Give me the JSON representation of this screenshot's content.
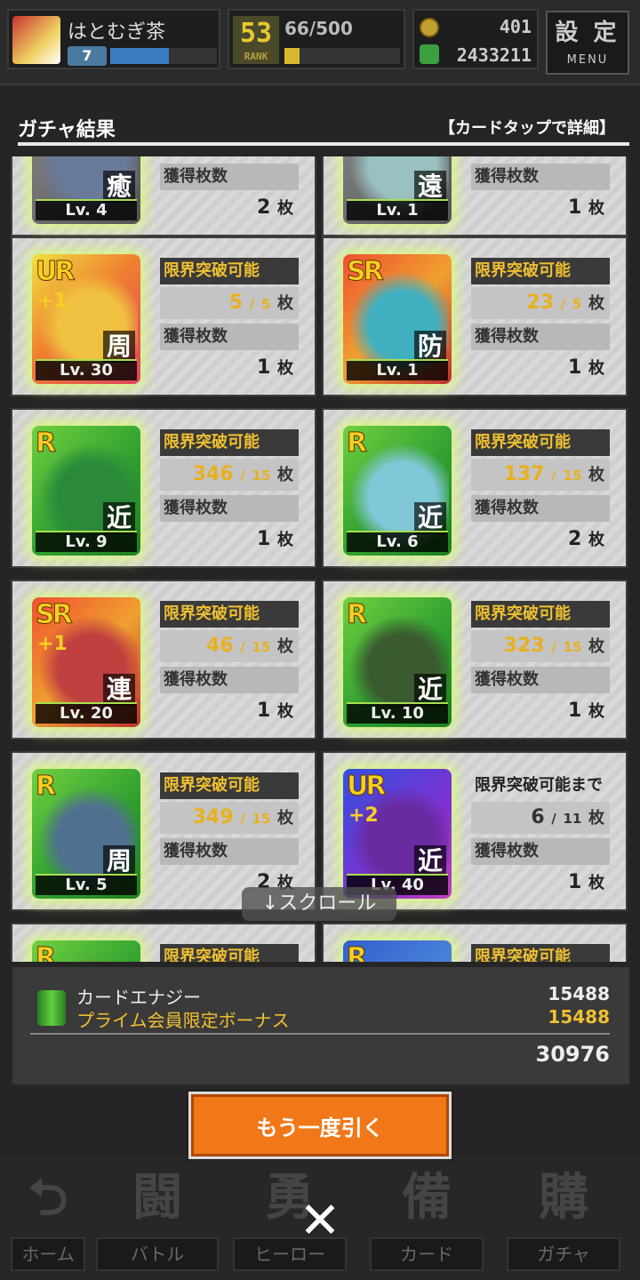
{
  "header": {
    "player_name": "はとむぎ茶",
    "player_level": "7",
    "player_exp": 0.55,
    "rank_number": "53",
    "rank_label": "RANK",
    "rank_progress": "66/500",
    "rank_fill": 0.13,
    "currency_coins": "401",
    "currency_energy": "2433211",
    "menu_kanji": "設 定",
    "menu_label": "MENU"
  },
  "title": "ガチャ結果",
  "hint": "【カードタップで詳細】",
  "cards": [
    {
      "rarity": "",
      "plus": "",
      "type": "癒",
      "level": "Lv. 4",
      "label1": "",
      "value1": "",
      "max1": "",
      "label2": "獲得枚数",
      "count": "2",
      "unit": "枚",
      "art": "#6a7a9a"
    },
    {
      "rarity": "",
      "plus": "",
      "type": "遠",
      "level": "Lv. 1",
      "label1": "",
      "value1": "",
      "max1": "",
      "label2": "獲得枚数",
      "count": "1",
      "unit": "枚",
      "art": "#9ac0c0"
    },
    {
      "rarity": "UR",
      "plus": "+1",
      "type": "周",
      "level": "Lv. 30",
      "label1": "限界突破可能",
      "value1": "5",
      "max1": "5",
      "label2": "獲得枚数",
      "count": "1",
      "unit": "枚",
      "art": "#f0c040"
    },
    {
      "rarity": "SR",
      "plus": "",
      "type": "防",
      "level": "Lv. 1",
      "label1": "限界突破可能",
      "value1": "23",
      "max1": "5",
      "label2": "獲得枚数",
      "count": "1",
      "unit": "枚",
      "art": "#40b0c0"
    },
    {
      "rarity": "R",
      "plus": "",
      "type": "近",
      "level": "Lv. 9",
      "label1": "限界突破可能",
      "value1": "346",
      "max1": "15",
      "label2": "獲得枚数",
      "count": "1",
      "unit": "枚",
      "art": "#2a8a3a"
    },
    {
      "rarity": "R",
      "plus": "",
      "type": "近",
      "level": "Lv. 6",
      "label1": "限界突破可能",
      "value1": "137",
      "max1": "15",
      "label2": "獲得枚数",
      "count": "2",
      "unit": "枚",
      "art": "#80c8d8"
    },
    {
      "rarity": "SR",
      "plus": "+1",
      "type": "連",
      "level": "Lv. 20",
      "label1": "限界突破可能",
      "value1": "46",
      "max1": "15",
      "label2": "獲得枚数",
      "count": "1",
      "unit": "枚",
      "art": "#c04040"
    },
    {
      "rarity": "R",
      "plus": "",
      "type": "近",
      "level": "Lv. 10",
      "label1": "限界突破可能",
      "value1": "323",
      "max1": "15",
      "label2": "獲得枚数",
      "count": "1",
      "unit": "枚",
      "art": "#3a5a30"
    },
    {
      "rarity": "R",
      "plus": "",
      "type": "周",
      "level": "Lv. 5",
      "label1": "限界突破可能",
      "value1": "349",
      "max1": "15",
      "label2": "獲得枚数",
      "count": "2",
      "unit": "枚",
      "art": "#507090"
    },
    {
      "rarity": "UR",
      "plus": "+2",
      "type": "近",
      "level": "Lv. 40",
      "label1": "限界突破可能まで",
      "value1": "6",
      "max1": "11",
      "label2": "獲得枚数",
      "count": "1",
      "unit": "枚",
      "art": "#6a2aa0"
    },
    {
      "rarity": "R",
      "plus": "",
      "type": "",
      "level": "",
      "label1": "限界突破可能",
      "value1": "",
      "max1": "",
      "label2": "",
      "count": "",
      "unit": "",
      "art": "#d04020"
    },
    {
      "rarity": "R",
      "plus": "",
      "type": "",
      "level": "",
      "label1": "限界突破可能",
      "value1": "",
      "max1": "",
      "label2": "",
      "count": "",
      "unit": "",
      "art": "#3060c0"
    }
  ],
  "scroll_hint": "↓スクロール",
  "energy": {
    "label": "カードエナジー",
    "bonus_label": "プライム会員限定ボーナス",
    "value": "15488",
    "bonus_value": "15488",
    "total": "30976"
  },
  "again_button": "もう一度引く",
  "nav": [
    {
      "kanji": "⮌",
      "label": "ホーム"
    },
    {
      "kanji": "闘",
      "label": "バトル"
    },
    {
      "kanji": "勇",
      "label": "ヒーロー"
    },
    {
      "kanji": "備",
      "label": "カード"
    },
    {
      "kanji": "購",
      "label": "ガチャ"
    }
  ],
  "close_symbol": "✕",
  "colors": {
    "accent_orange": "#f07818",
    "gold": "#f0c030",
    "energy_green": "#3ca040"
  }
}
